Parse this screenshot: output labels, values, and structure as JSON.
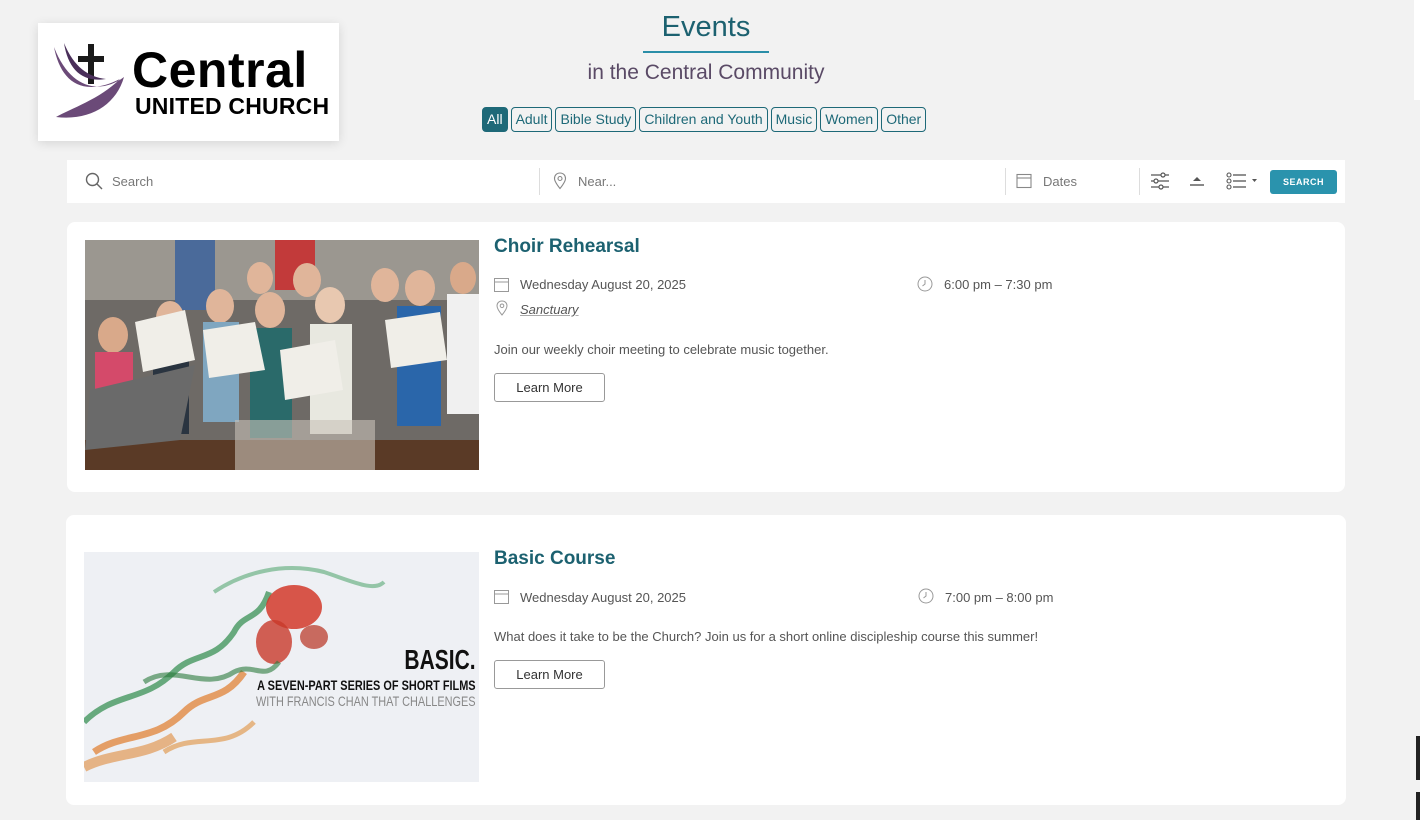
{
  "logo": {
    "word1": "Central",
    "word2": "UNITED CHURCH"
  },
  "header": {
    "title": "Events",
    "subtitle": "in the Central Community"
  },
  "filters": [
    "All",
    "Adult",
    "Bible Study",
    "Children and Youth",
    "Music",
    "Women",
    "Other"
  ],
  "search": {
    "search_placeholder": "Search",
    "near_placeholder": "Near...",
    "dates_placeholder": "Dates",
    "button_label": "SEARCH"
  },
  "events": [
    {
      "title": "Choir Rehearsal",
      "date": "Wednesday August 20, 2025",
      "time": "6:00 pm – 7:30 pm",
      "venue": "Sanctuary",
      "description": "Join our weekly choir meeting to celebrate music together.",
      "button": "Learn More"
    },
    {
      "title": "Basic Course",
      "date": "Wednesday August 20, 2025",
      "time": "7:00 pm – 8:00 pm",
      "description": "What does it take to be the Church? Join us for a short online discipleship course this summer!",
      "button": "Learn More",
      "image_text": {
        "line1": "BASIC.",
        "line2": "A SEVEN-PART SERIES OF SHORT FILMS",
        "line3": "WITH FRANCIS CHAN THAT CHALLENGES"
      }
    }
  ],
  "colors": {
    "accent": "#1e6978",
    "button": "#2a93ad",
    "subtitle": "#5a4a66"
  }
}
